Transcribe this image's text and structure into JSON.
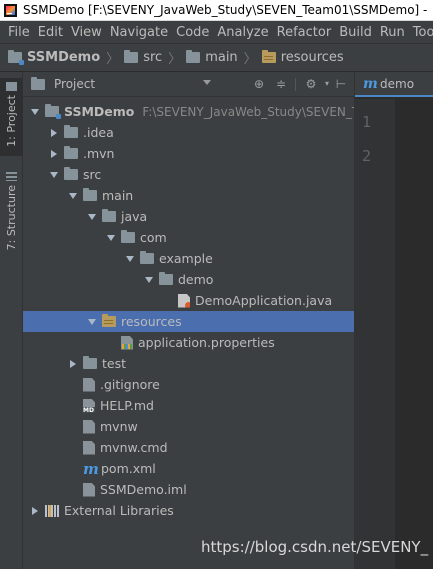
{
  "window": {
    "title": "SSMDemo [F:\\SEVENY_JavaWeb_Study\\SEVEN_Team01\\SSMDemo] -"
  },
  "menu": [
    "File",
    "Edit",
    "View",
    "Navigate",
    "Code",
    "Analyze",
    "Refactor",
    "Build",
    "Run",
    "Too"
  ],
  "breadcrumb": [
    "SSMDemo",
    "src",
    "main",
    "resources"
  ],
  "left_tool_tabs": [
    {
      "label": "1: Project",
      "icon": "project-icon",
      "active": true
    },
    {
      "label": "7: Structure",
      "icon": "structure-icon",
      "active": false
    }
  ],
  "project_panel": {
    "title": "Project",
    "header_icons": [
      "globe-icon",
      "collapse-icon",
      "gear-icon",
      "hide-icon"
    ]
  },
  "tree": [
    {
      "label": "SSMDemo",
      "hint": "F:\\SEVENY_JavaWeb_Study\\SEVEN_Te",
      "arrow": "down",
      "icon": "module-folder",
      "depth": 0,
      "bold": true
    },
    {
      "label": ".idea",
      "arrow": "right",
      "icon": "folder",
      "depth": 1
    },
    {
      "label": ".mvn",
      "arrow": "right",
      "icon": "folder",
      "depth": 1
    },
    {
      "label": "src",
      "arrow": "down",
      "icon": "folder",
      "depth": 1
    },
    {
      "label": "main",
      "arrow": "down",
      "icon": "folder",
      "depth": 2
    },
    {
      "label": "java",
      "arrow": "down",
      "icon": "folder",
      "depth": 3
    },
    {
      "label": "com",
      "arrow": "down",
      "icon": "folder",
      "depth": 4
    },
    {
      "label": "example",
      "arrow": "down",
      "icon": "folder",
      "depth": 5
    },
    {
      "label": "demo",
      "arrow": "down",
      "icon": "folder",
      "depth": 6
    },
    {
      "label": "DemoApplication.java",
      "arrow": "none",
      "icon": "java-file",
      "depth": 7
    },
    {
      "label": "resources",
      "arrow": "down",
      "icon": "resources-folder",
      "depth": 3,
      "selected": true
    },
    {
      "label": "application.properties",
      "arrow": "none",
      "icon": "properties-file",
      "depth": 4
    },
    {
      "label": "test",
      "arrow": "right",
      "icon": "folder",
      "depth": 2
    },
    {
      "label": ".gitignore",
      "arrow": "none",
      "icon": "text-file",
      "depth": 2
    },
    {
      "label": "HELP.md",
      "arrow": "none",
      "icon": "md-file",
      "depth": 2
    },
    {
      "label": "mvnw",
      "arrow": "none",
      "icon": "text-file",
      "depth": 2
    },
    {
      "label": "mvnw.cmd",
      "arrow": "none",
      "icon": "text-file",
      "depth": 2
    },
    {
      "label": "pom.xml",
      "arrow": "none",
      "icon": "maven-file",
      "depth": 2
    },
    {
      "label": "SSMDemo.iml",
      "arrow": "none",
      "icon": "iml-file",
      "depth": 2
    },
    {
      "label": "External Libraries",
      "arrow": "right",
      "icon": "libraries",
      "depth": 0
    }
  ],
  "editor": {
    "tab_label": "demo",
    "line_numbers": [
      "1",
      "2"
    ]
  },
  "watermark": "https://blog.csdn.net/SEVENY_"
}
